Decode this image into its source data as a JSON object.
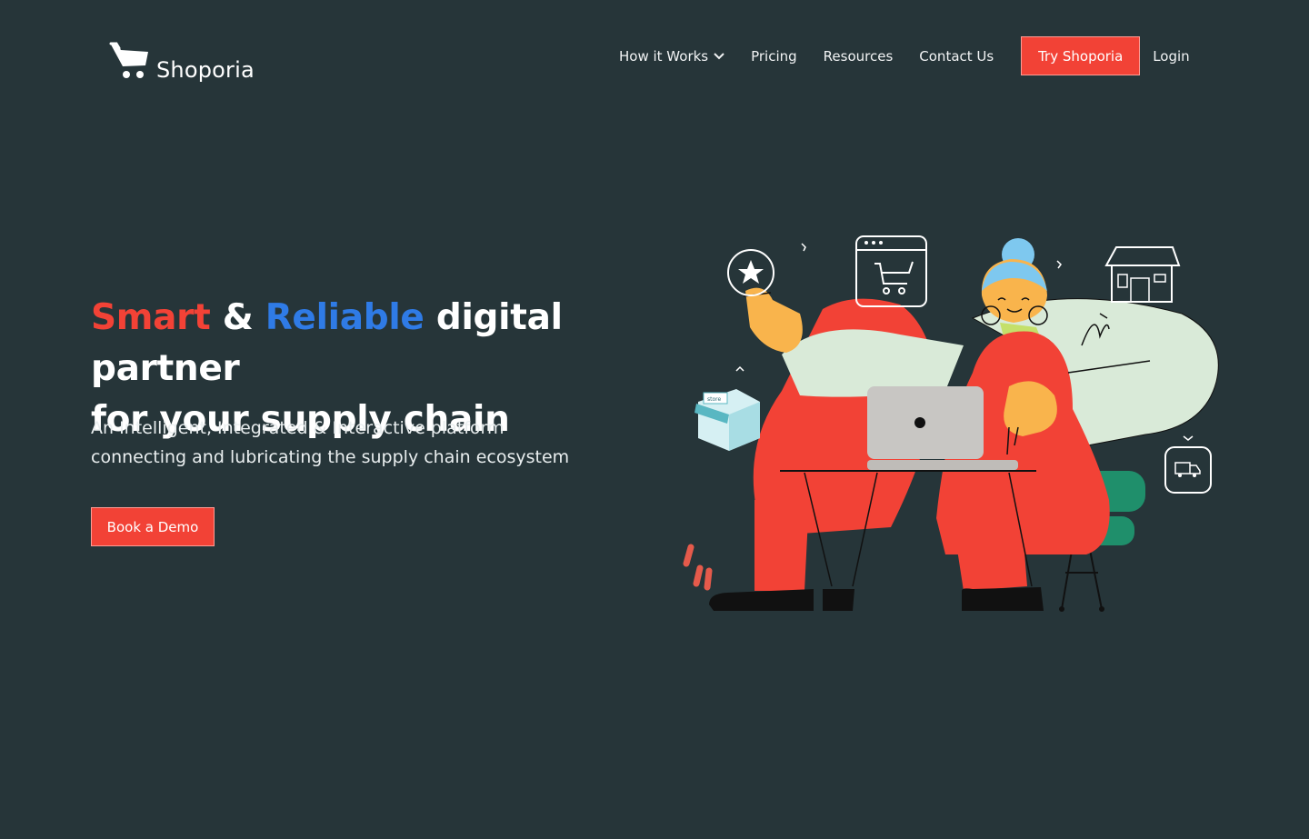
{
  "brand": {
    "name": "Shoporia",
    "logo_icon": "shopping-cart-icon"
  },
  "nav": {
    "items": [
      {
        "label": "How it Works",
        "has_dropdown": true
      },
      {
        "label": "Pricing"
      },
      {
        "label": "Resources"
      },
      {
        "label": "Contact Us"
      }
    ],
    "cta_label": "Try Shoporia",
    "login_label": "Login"
  },
  "hero": {
    "title_smart": "Smart",
    "title_amp": "&",
    "title_reliable": "Reliable",
    "title_rest_line1": "digital partner",
    "title_line2": "for your supply chain",
    "subtitle_line1": "An Intelligent, Integrated & Interactive platform",
    "subtitle_line2": "connecting and lubricating the supply chain ecosystem",
    "cta_label": "Book a Demo"
  },
  "illustration": {
    "store_sign_text": "store",
    "icons": [
      "star-icon",
      "browser-cart-icon",
      "storefront-icon",
      "delivery-truck-icon",
      "small-store-icon"
    ]
  },
  "colors": {
    "background": "#263539",
    "accent_red": "#f24236",
    "accent_blue": "#2f7be6",
    "text": "#ffffff"
  }
}
